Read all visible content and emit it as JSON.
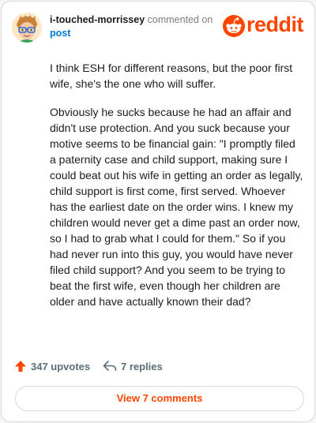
{
  "header": {
    "username": "i-touched-morrissey",
    "action_text": "commented on",
    "post_link": "post",
    "logo_text": "reddit"
  },
  "comment": {
    "paragraphs": [
      "I think ESH for different reasons, but the poor first wife, she's the one who will suffer.",
      "Obviously he sucks because he had an affair and didn't use protection. And you suck because your motive seems to be financial gain: \"I promptly filed a paternity case and child support, making sure I could beat out his wife in getting an order as legally, child support is first come, first served. Whoever has the earliest date on the order wins. I knew my children would never get a dime past an order now, so I had to grab what I could for them.\" So if you had never run into this guy, you would have never filed child support? And you seem to be trying to beat the first wife, even though her children are older and have actually known their dad?"
    ]
  },
  "actions": {
    "upvotes": "347 upvotes",
    "replies": "7 replies",
    "view_comments": "View 7 comments"
  },
  "icons": {
    "upvote": "upvote-arrow-icon",
    "reply": "reply-arrow-icon",
    "logo": "reddit-snoo-icon"
  },
  "colors": {
    "brand": "#ff4500",
    "link": "#0079d3",
    "muted": "#576f76",
    "text": "#1c1c1c"
  }
}
